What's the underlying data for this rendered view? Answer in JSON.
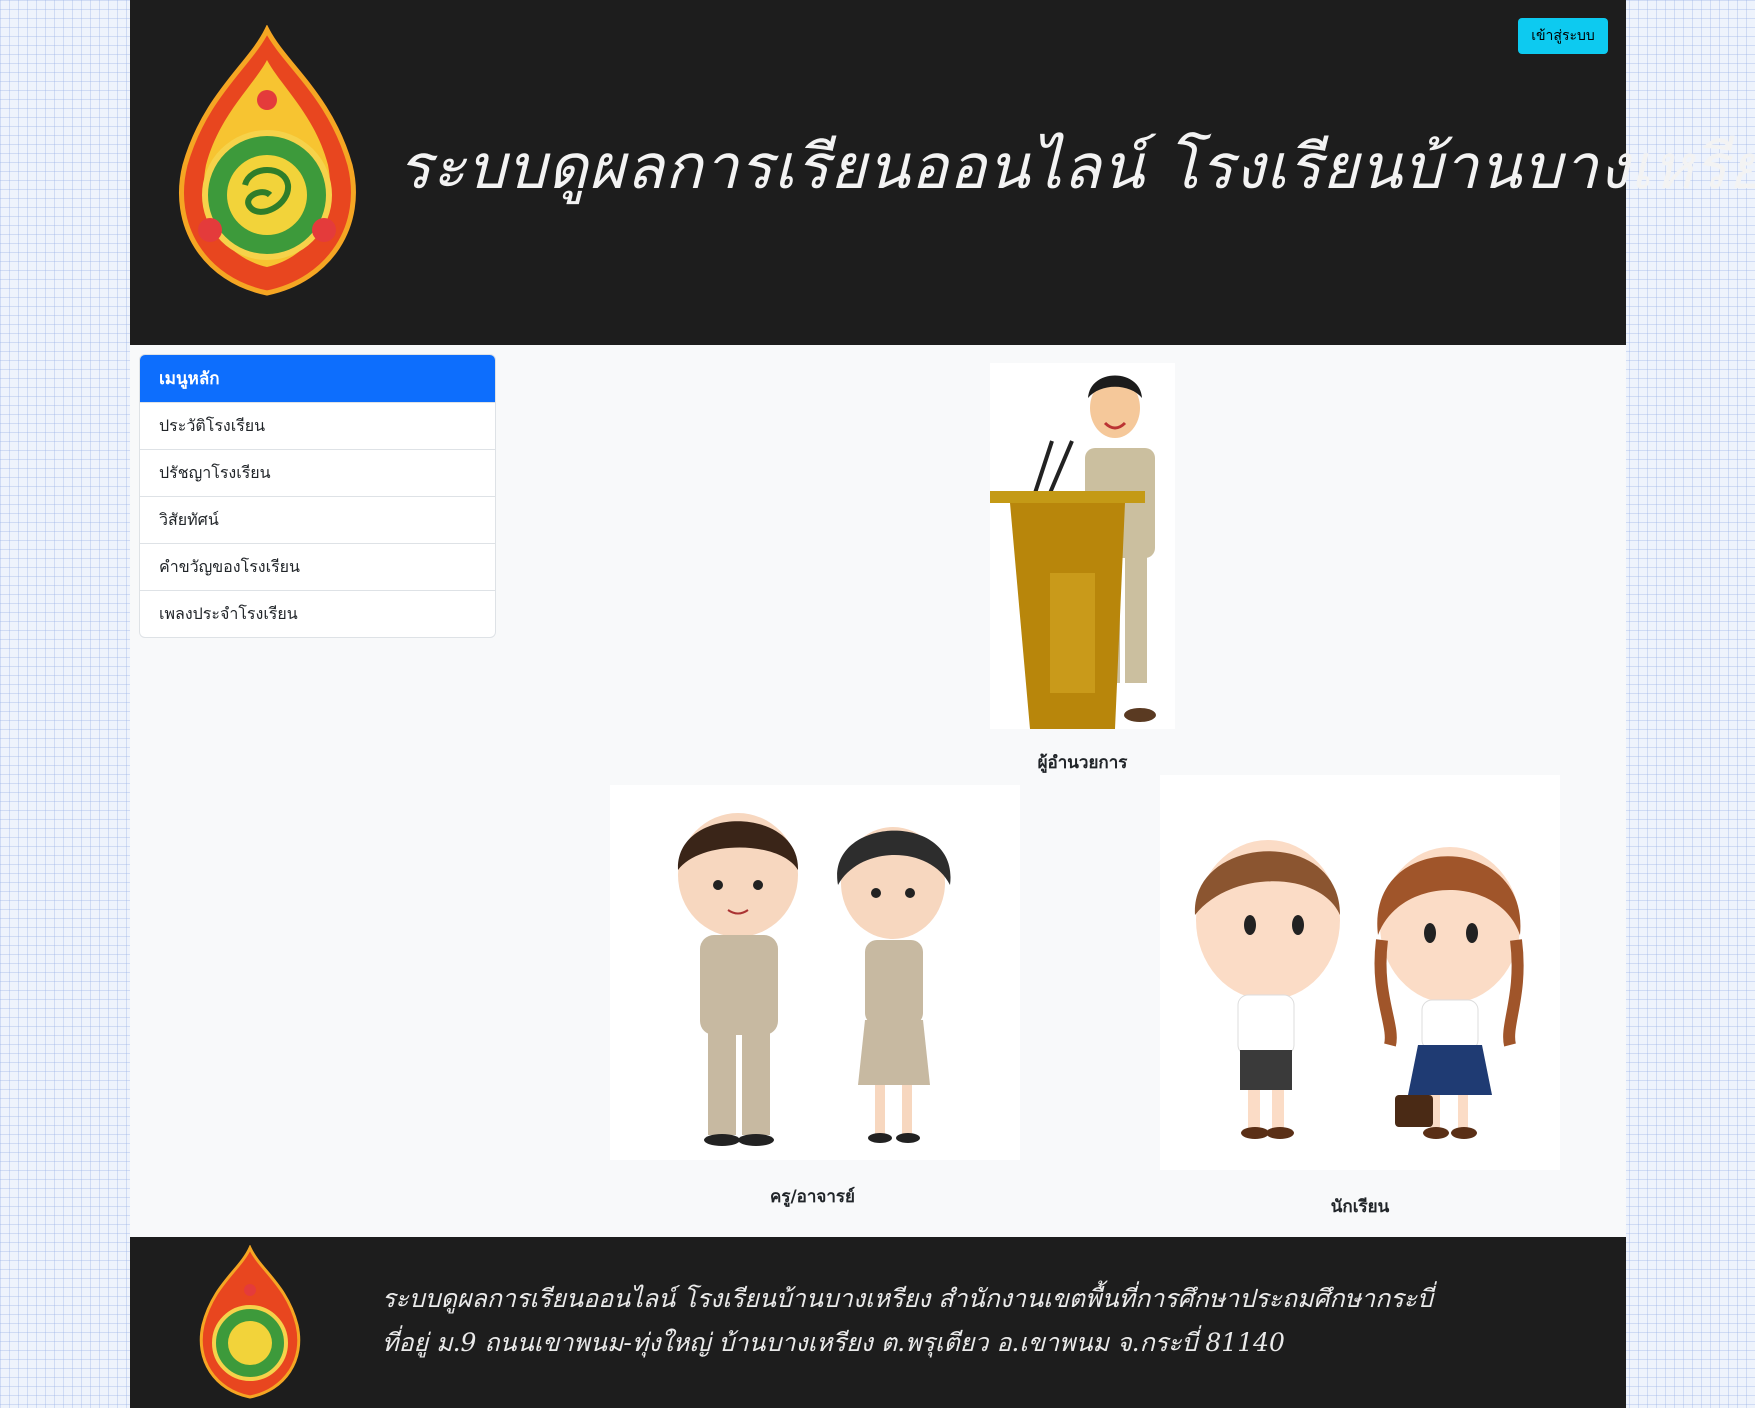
{
  "header": {
    "title": "ระบบดูผลการเรียนออนไลน์ โรงเรียนบ้านบางเหรียง",
    "login_label": "เข้าสู่ระบบ"
  },
  "menu": {
    "heading": "เมนูหลัก",
    "items": [
      {
        "label": "ประวัติโรงเรียน"
      },
      {
        "label": "ปรัชญาโรงเรียน"
      },
      {
        "label": "วิสัยทัศน์"
      },
      {
        "label": "คำขวัญของโรงเรียน"
      },
      {
        "label": "เพลงประจำโรงเรียน"
      }
    ]
  },
  "cards": {
    "director": "ผู้อำนวยการ",
    "teachers": "ครู/อาจารย์",
    "students": "นักเรียน"
  },
  "footer": {
    "line1": "ระบบดูผลการเรียนออนไลน์  โรงเรียนบ้านบางเหรียง   สำนักงานเขตพื้นที่การศึกษาประถมศึกษากระบี่",
    "line2": "ที่อยู่ ม.9 ถนนเขาพนม-ทุ่งใหญ่   บ้านบางเหรียง   ต.พรุเตียว   อ.เขาพนม  จ.กระบี่   81140"
  },
  "colors": {
    "header_bg": "#1d1d1d",
    "menu_active": "#0d6efd",
    "login_button": "#0dcaf0"
  }
}
